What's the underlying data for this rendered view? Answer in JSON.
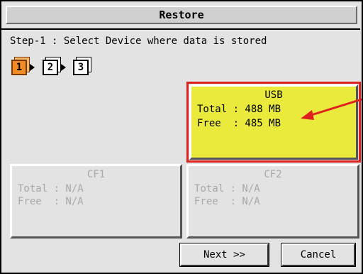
{
  "window": {
    "title": "Restore"
  },
  "step": {
    "instruction": "Step-1 : Select Device where data is stored",
    "steps": [
      "1",
      "2",
      "3"
    ],
    "active_step": "1"
  },
  "devices": {
    "usb": {
      "name": "USB",
      "total": "Total : 488 MB",
      "free": "Free  : 485 MB",
      "selected": true
    },
    "cf1": {
      "name": "CF1",
      "total": "Total : N/A",
      "free": "Free  : N/A",
      "enabled": false
    },
    "cf2": {
      "name": "CF2",
      "total": "Total : N/A",
      "free": "Free  : N/A",
      "enabled": false
    }
  },
  "buttons": {
    "next": "Next >>",
    "cancel": "Cancel"
  },
  "colors": {
    "usb_fill": "#eaea3c",
    "highlight_outline": "#e0201e",
    "active_step": "#f28c28"
  }
}
